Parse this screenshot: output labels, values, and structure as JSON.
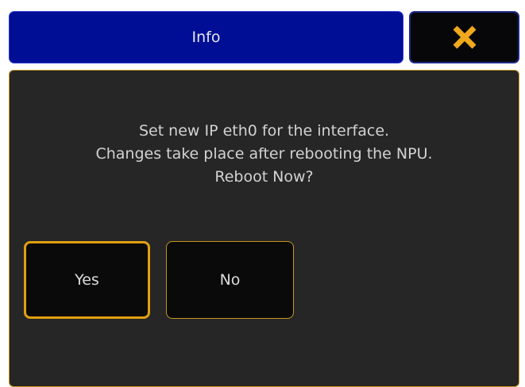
{
  "dialog": {
    "title": "Info",
    "message_lines": [
      "Set new IP eth0 for the interface.",
      "Changes take place after rebooting the NPU.",
      "Reboot Now?"
    ],
    "buttons": {
      "yes": "Yes",
      "no": "No"
    },
    "close_icon": "close-icon",
    "colors": {
      "title_bar": "#000e96",
      "accent": "#e0a010",
      "close_icon": "#f0a81c",
      "body_bg": "#262626"
    }
  }
}
